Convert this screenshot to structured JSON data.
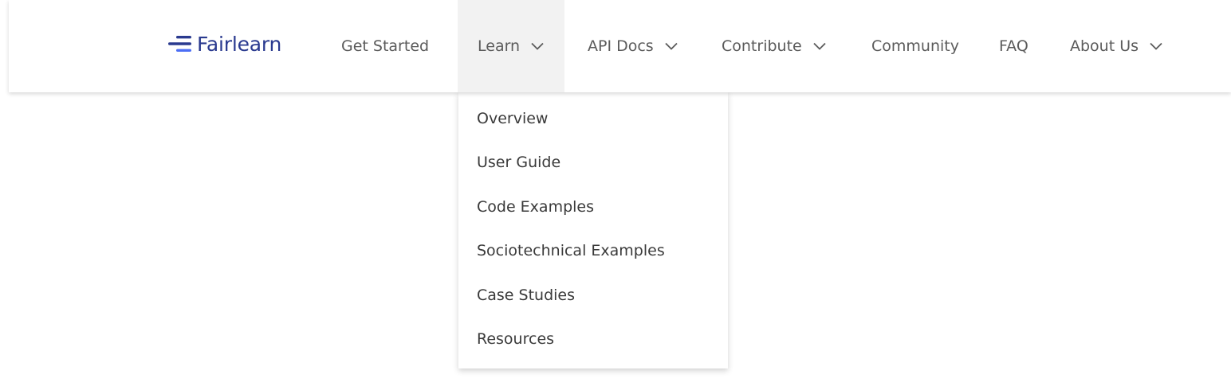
{
  "brand": {
    "name": "Fairlearn",
    "color": "#2a3a8f",
    "accent": "#4c6ef5"
  },
  "nav": {
    "items": [
      {
        "label": "Get Started",
        "has_dropdown": false,
        "active": false
      },
      {
        "label": "Learn",
        "has_dropdown": true,
        "active": true
      },
      {
        "label": "API Docs",
        "has_dropdown": true,
        "active": false
      },
      {
        "label": "Contribute",
        "has_dropdown": true,
        "active": false
      },
      {
        "label": "Community",
        "has_dropdown": false,
        "active": false
      },
      {
        "label": "FAQ",
        "has_dropdown": false,
        "active": false
      },
      {
        "label": "About Us",
        "has_dropdown": true,
        "active": false
      }
    ],
    "chevron_icon": "chevron-down-icon"
  },
  "learn_menu": {
    "items": [
      "Overview",
      "User Guide",
      "Code Examples",
      "Sociotechnical Examples",
      "Case Studies",
      "Resources"
    ]
  }
}
